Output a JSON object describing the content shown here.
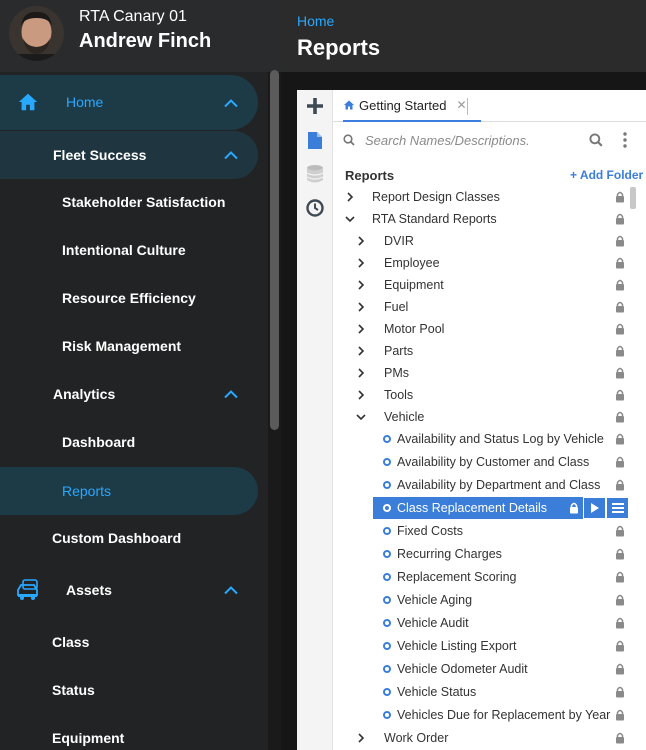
{
  "profile": {
    "org": "RTA Canary 01",
    "user": "Andrew Finch"
  },
  "nav": {
    "home": "Home",
    "fleet_success": "Fleet Success",
    "stakeholder": "Stakeholder Satisfaction",
    "intentional": "Intentional Culture",
    "resource": "Resource Efficiency",
    "risk": "Risk Management",
    "analytics": "Analytics",
    "dashboard": "Dashboard",
    "reports": "Reports",
    "custom_dashboard": "Custom Dashboard",
    "assets": "Assets",
    "class": "Class",
    "status": "Status",
    "equipment": "Equipment"
  },
  "header": {
    "breadcrumb": "Home",
    "title": "Reports"
  },
  "panel": {
    "tab_label": "Getting Started",
    "search_placeholder": "Search Names/Descriptions.",
    "tree_header": "Reports",
    "add_folder": "+ Add Folder",
    "tree": {
      "report_design": "Report Design Classes",
      "rta_standard": "RTA Standard Reports",
      "dvir": "DVIR",
      "employee": "Employee",
      "equipment": "Equipment",
      "fuel": "Fuel",
      "motor_pool": "Motor Pool",
      "parts": "Parts",
      "pms": "PMs",
      "tools": "Tools",
      "vehicle": "Vehicle",
      "availability_status_log": "Availability and Status Log by Vehicle",
      "availability_customer": "Availability by Customer and Class",
      "availability_department": "Availability by Department and Class",
      "class_replacement": "Class Replacement Details",
      "fixed_costs": "Fixed Costs",
      "recurring_charges": "Recurring Charges",
      "replacement_scoring": "Replacement Scoring",
      "vehicle_aging": "Vehicle Aging",
      "vehicle_audit": "Vehicle Audit",
      "vehicle_listing_export": "Vehicle Listing Export",
      "vehicle_odometer_audit": "Vehicle Odometer Audit",
      "vehicle_status": "Vehicle Status",
      "vehicles_due": "Vehicles Due for Replacement by Year",
      "work_order": "Work Order"
    }
  },
  "colors": {
    "accent": "#29a8ff",
    "selection": "#3b7ed9",
    "nav_bg": "#222324",
    "active_item_bg": "#1d3a47"
  },
  "icons": [
    "home-icon",
    "chevron-up-icon",
    "car-icon",
    "plus-icon",
    "document-icon",
    "database-icon",
    "clock-icon",
    "search-icon",
    "more-vert-icon",
    "caret-right-icon",
    "caret-down-icon",
    "lock-icon",
    "play-icon",
    "menu-icon"
  ]
}
